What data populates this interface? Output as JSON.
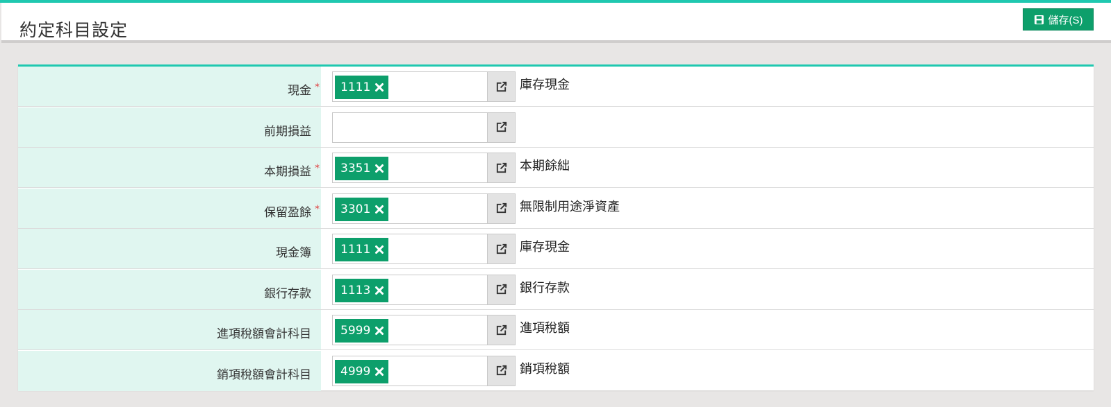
{
  "header": {
    "title": "約定科目設定",
    "save_label": "儲存(S)"
  },
  "colors": {
    "accent": "#1fc8b0",
    "primary": "#0d9f6b",
    "label_bg": "#e0f6f0",
    "required": "#e04444"
  },
  "rows": [
    {
      "label": "現金",
      "required": true,
      "code": "1111",
      "name": "庫存現金"
    },
    {
      "label": "前期損益",
      "required": false,
      "code": "",
      "name": ""
    },
    {
      "label": "本期損益",
      "required": true,
      "code": "3351",
      "name": "本期餘絀"
    },
    {
      "label": "保留盈餘",
      "required": true,
      "code": "3301",
      "name": "無限制用途淨資產"
    },
    {
      "label": "現金簿",
      "required": false,
      "code": "1111",
      "name": "庫存現金"
    },
    {
      "label": "銀行存款",
      "required": false,
      "code": "1113",
      "name": "銀行存款"
    },
    {
      "label": "進項稅額會計科目",
      "required": false,
      "code": "5999",
      "name": "進項稅額"
    },
    {
      "label": "銷項稅額會計科目",
      "required": false,
      "code": "4999",
      "name": "銷項稅額"
    }
  ],
  "icons": {
    "save": "floppy-disk-icon",
    "remove": "close-icon",
    "link": "external-link-icon"
  },
  "required_mark": "*"
}
